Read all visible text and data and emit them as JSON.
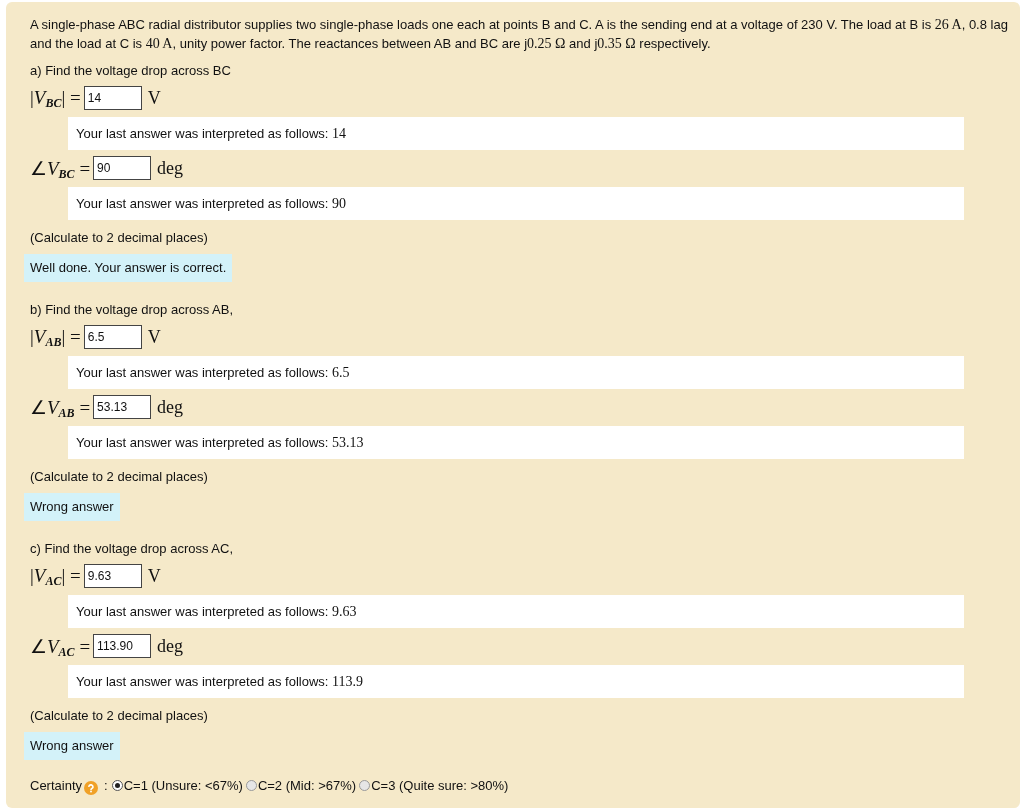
{
  "intro": {
    "segments": [
      {
        "kind": "text",
        "text": "A single-phase ABC radial distributor supplies two single-phase loads one each at points B and C. A is the sending end at a voltage of 230 V. The load at B is "
      },
      {
        "kind": "math",
        "text": "26 A"
      },
      {
        "kind": "text",
        "text": ", 0.8 lag and the load at C is "
      },
      {
        "kind": "math",
        "text": "40 A"
      },
      {
        "kind": "text",
        "text": ", unity power factor. The reactances between AB and BC are j"
      },
      {
        "kind": "math",
        "text": "0.25 Ω"
      },
      {
        "kind": "text",
        "text": " and j"
      },
      {
        "kind": "math",
        "text": "0.35 Ω"
      },
      {
        "kind": "text",
        "text": " respectively."
      }
    ]
  },
  "parts": [
    {
      "prompt": "a) Find the voltage drop across BC",
      "answers": [
        {
          "label": "|*V*$_{BC}$| =",
          "value": "14",
          "unit": "V",
          "feedback": {
            "text": "Your last answer was interpreted as follows:",
            "value": "14"
          }
        },
        {
          "label": "∠*V*$_{BC}$ =",
          "value": "90",
          "unit": "deg",
          "feedback": {
            "text": "Your last answer was interpreted as follows:",
            "value": "90"
          }
        }
      ],
      "note": "(Calculate to 2 decimal places)",
      "result": "Well done. Your answer is correct."
    },
    {
      "prompt": "b) Find the voltage drop across AB,",
      "answers": [
        {
          "label": "|*V*$_{AB}$| =",
          "value": "6.5",
          "unit": "V",
          "feedback": {
            "text": "Your last answer was interpreted as follows:",
            "value": "6.5"
          }
        },
        {
          "label": "∠*V*$_{AB}$ =",
          "value": "53.13",
          "unit": "deg",
          "feedback": {
            "text": "Your last answer was interpreted as follows:",
            "value": "53.13"
          }
        }
      ],
      "note": "(Calculate to 2 decimal places)",
      "result": "Wrong answer"
    },
    {
      "prompt": "c) Find the voltage drop across AC,",
      "answers": [
        {
          "label": "|*V*$_{AC}$| =",
          "value": "9.63",
          "unit": "V",
          "feedback": {
            "text": "Your last answer was interpreted as follows:",
            "value": "9.63"
          }
        },
        {
          "label": "∠*V*$_{AC}$ =",
          "value": "113.90",
          "unit": "deg",
          "feedback": {
            "text": "Your last answer was interpreted as follows:",
            "value": "113.9"
          }
        }
      ],
      "note": "(Calculate to 2 decimal places)",
      "result": "Wrong answer"
    }
  ],
  "certainty": {
    "label": "Certainty",
    "separator": ":",
    "options": [
      {
        "label": "C=1 (Unsure: <67%)",
        "selected": true
      },
      {
        "label": "C=2 (Mid: >67%)",
        "selected": false
      },
      {
        "label": "C=3 (Quite sure: >80%)",
        "selected": false
      }
    ]
  }
}
